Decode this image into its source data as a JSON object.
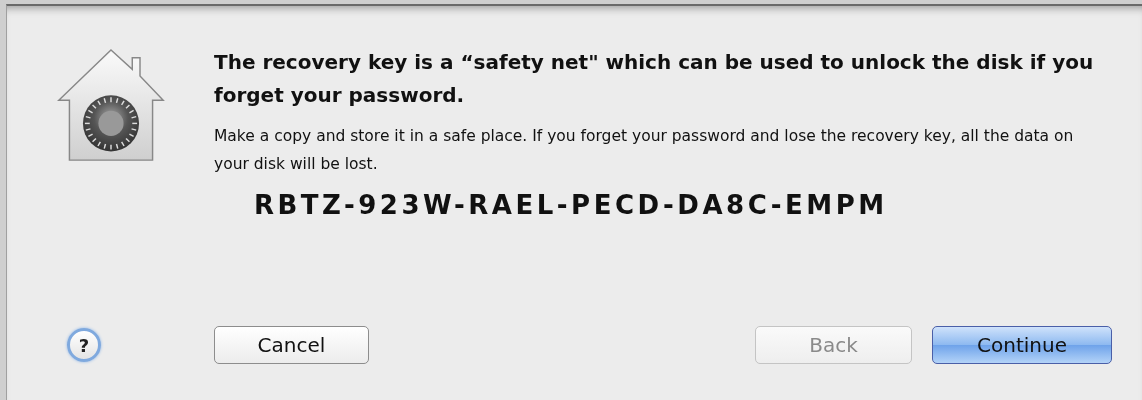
{
  "dialog": {
    "title": "The recovery key is a “safety net\" which can be used to unlock the disk if you forget your password.",
    "message": "Make a copy and store it in a safe place. If you forget your password and lose the recovery key, all the data on your disk will be lost.",
    "recovery_key": "RBTZ-923W-RAEL-PECD-DA8C-EMPM"
  },
  "help_button": {
    "label": "?"
  },
  "buttons": [
    {
      "label": "Cancel",
      "kind": "normal",
      "disabled": false
    },
    {
      "label": "Back",
      "kind": "normal",
      "disabled": true
    },
    {
      "label": "Continue",
      "kind": "default",
      "disabled": false
    }
  ]
}
